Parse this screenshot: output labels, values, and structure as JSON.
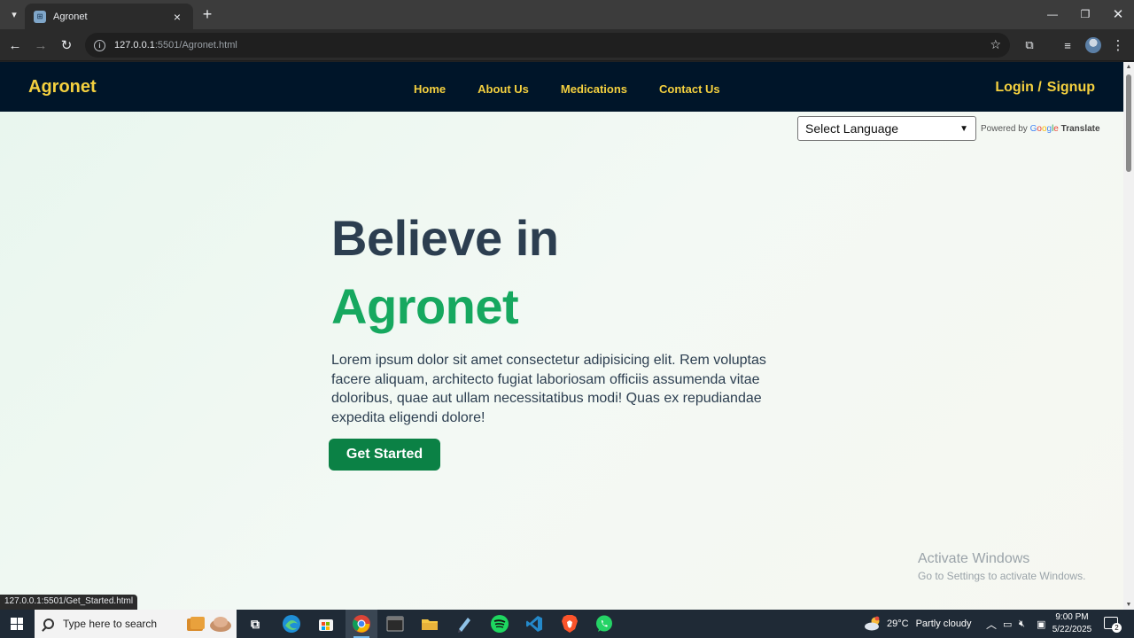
{
  "browser": {
    "tab_title": "Agronet",
    "url_host": "127.0.0.1",
    "url_rest": ":5501/Agronet.html",
    "status_url": "127.0.0.1:5501/Get_Started.html"
  },
  "site": {
    "brand": "Agronet",
    "nav": [
      "Home",
      "About Us",
      "Medications",
      "Contact Us"
    ],
    "login": "Login /",
    "signup": "Signup",
    "translate": {
      "select_label": "Select Language",
      "powered_by": "Powered by",
      "google": "Google",
      "translate_word": "Translate"
    },
    "hero": {
      "title_line1": "Believe in",
      "title_line2": "Agronet",
      "text": "Lorem ipsum dolor sit amet consectetur adipisicing elit. Rem voluptas facere aliquam, architecto fugiat laboriosam officiis assumenda vitae doloribus, quae aut ullam necessitatibus modi! Quas ex repudiandae expedita eligendi dolore!",
      "cta": "Get Started"
    },
    "watermark": {
      "title": "Activate Windows",
      "subtitle": "Go to Settings to activate Windows."
    },
    "colors": {
      "nav_bg": "#001529",
      "accent_yellow": "#f4d03f",
      "title_dark": "#2c3e50",
      "title_green": "#16a85f",
      "cta_green": "#0b8145"
    }
  },
  "taskbar": {
    "search_placeholder": "Type here to search",
    "weather_temp": "29°C",
    "weather_text": "Partly cloudy",
    "time": "9:00 PM",
    "date": "5/22/2025",
    "notification_count": "2",
    "apps": [
      "task-view-icon",
      "edge-icon",
      "store-icon",
      "chrome-icon",
      "terminal-icon",
      "file-explorer-icon",
      "notepad-icon",
      "spotify-icon",
      "vscode-icon",
      "brave-icon",
      "whatsapp-icon"
    ]
  }
}
